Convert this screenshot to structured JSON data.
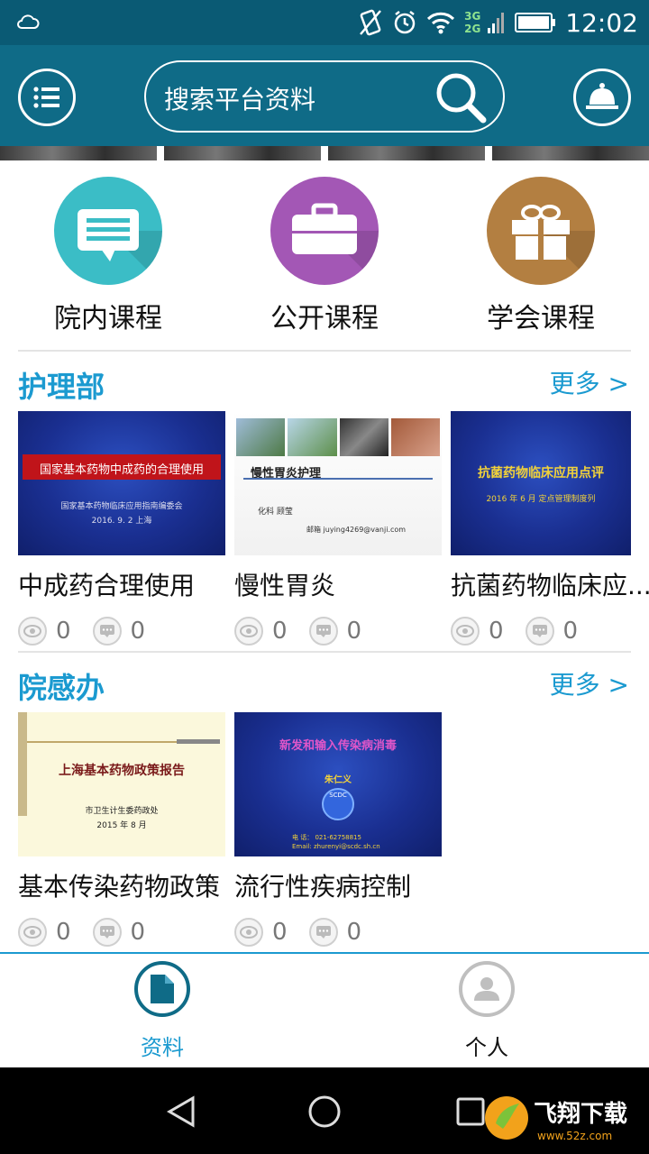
{
  "status_bar": {
    "time": "12:02",
    "network_top": "3G",
    "network_bottom": "2G"
  },
  "header": {
    "search_placeholder": "搜索平台资料",
    "menu_icon": "list-menu-icon",
    "search_icon": "magnifier-icon",
    "notify_icon": "bell-icon"
  },
  "categories": [
    {
      "label": "院内课程",
      "icon": "chat-bubble-icon",
      "color": "#3bbdc6"
    },
    {
      "label": "公开课程",
      "icon": "briefcase-icon",
      "color": "#a357b5"
    },
    {
      "label": "学会课程",
      "icon": "gift-icon",
      "color": "#b37f41"
    }
  ],
  "sections": [
    {
      "title": "护理部",
      "more": "更多 >",
      "items": [
        {
          "title": "中成药合理使用",
          "views": "0",
          "comments": "0",
          "slide_title": "国家基本药物中成药的合理使用",
          "slide_sub": "国家基本药物临床应用指南编委会",
          "slide_date": "2016. 9. 2    上海"
        },
        {
          "title": "慢性胃炎",
          "views": "0",
          "comments": "0",
          "slide_title": "慢性胃炎护理",
          "slide_sub": "化科      顾莹",
          "slide_email": "邮箱  juying4269@vanji.com"
        },
        {
          "title": "抗菌药物临床应...",
          "views": "0",
          "comments": "0",
          "slide_title": "抗菌药物临床应用点评",
          "slide_sub": "2016 年 6 月      定点管理制度列"
        }
      ]
    },
    {
      "title": "院感办",
      "more": "更多 >",
      "items": [
        {
          "title": "基本传染药物政策",
          "views": "0",
          "comments": "0",
          "slide_title": "上海基本药物政策报告",
          "slide_sub": "市卫生计生委药政处",
          "slide_date": "2015 年 8 月"
        },
        {
          "title": "流行性疾病控制",
          "views": "0",
          "comments": "0",
          "slide_title": "新发和输入传染病消毒",
          "slide_author": "朱仁义",
          "slide_org": "SCDC",
          "slide_phone": "电 话： 021-62758815",
          "slide_email": "Email: zhurenyi@scdc.sh.cn"
        }
      ]
    }
  ],
  "bottom_nav": [
    {
      "label": "资料",
      "icon": "document-icon",
      "active": true
    },
    {
      "label": "个人",
      "icon": "person-icon",
      "active": false
    }
  ],
  "colors": {
    "primary": "#0f6b87",
    "accent": "#1b9ad0"
  }
}
